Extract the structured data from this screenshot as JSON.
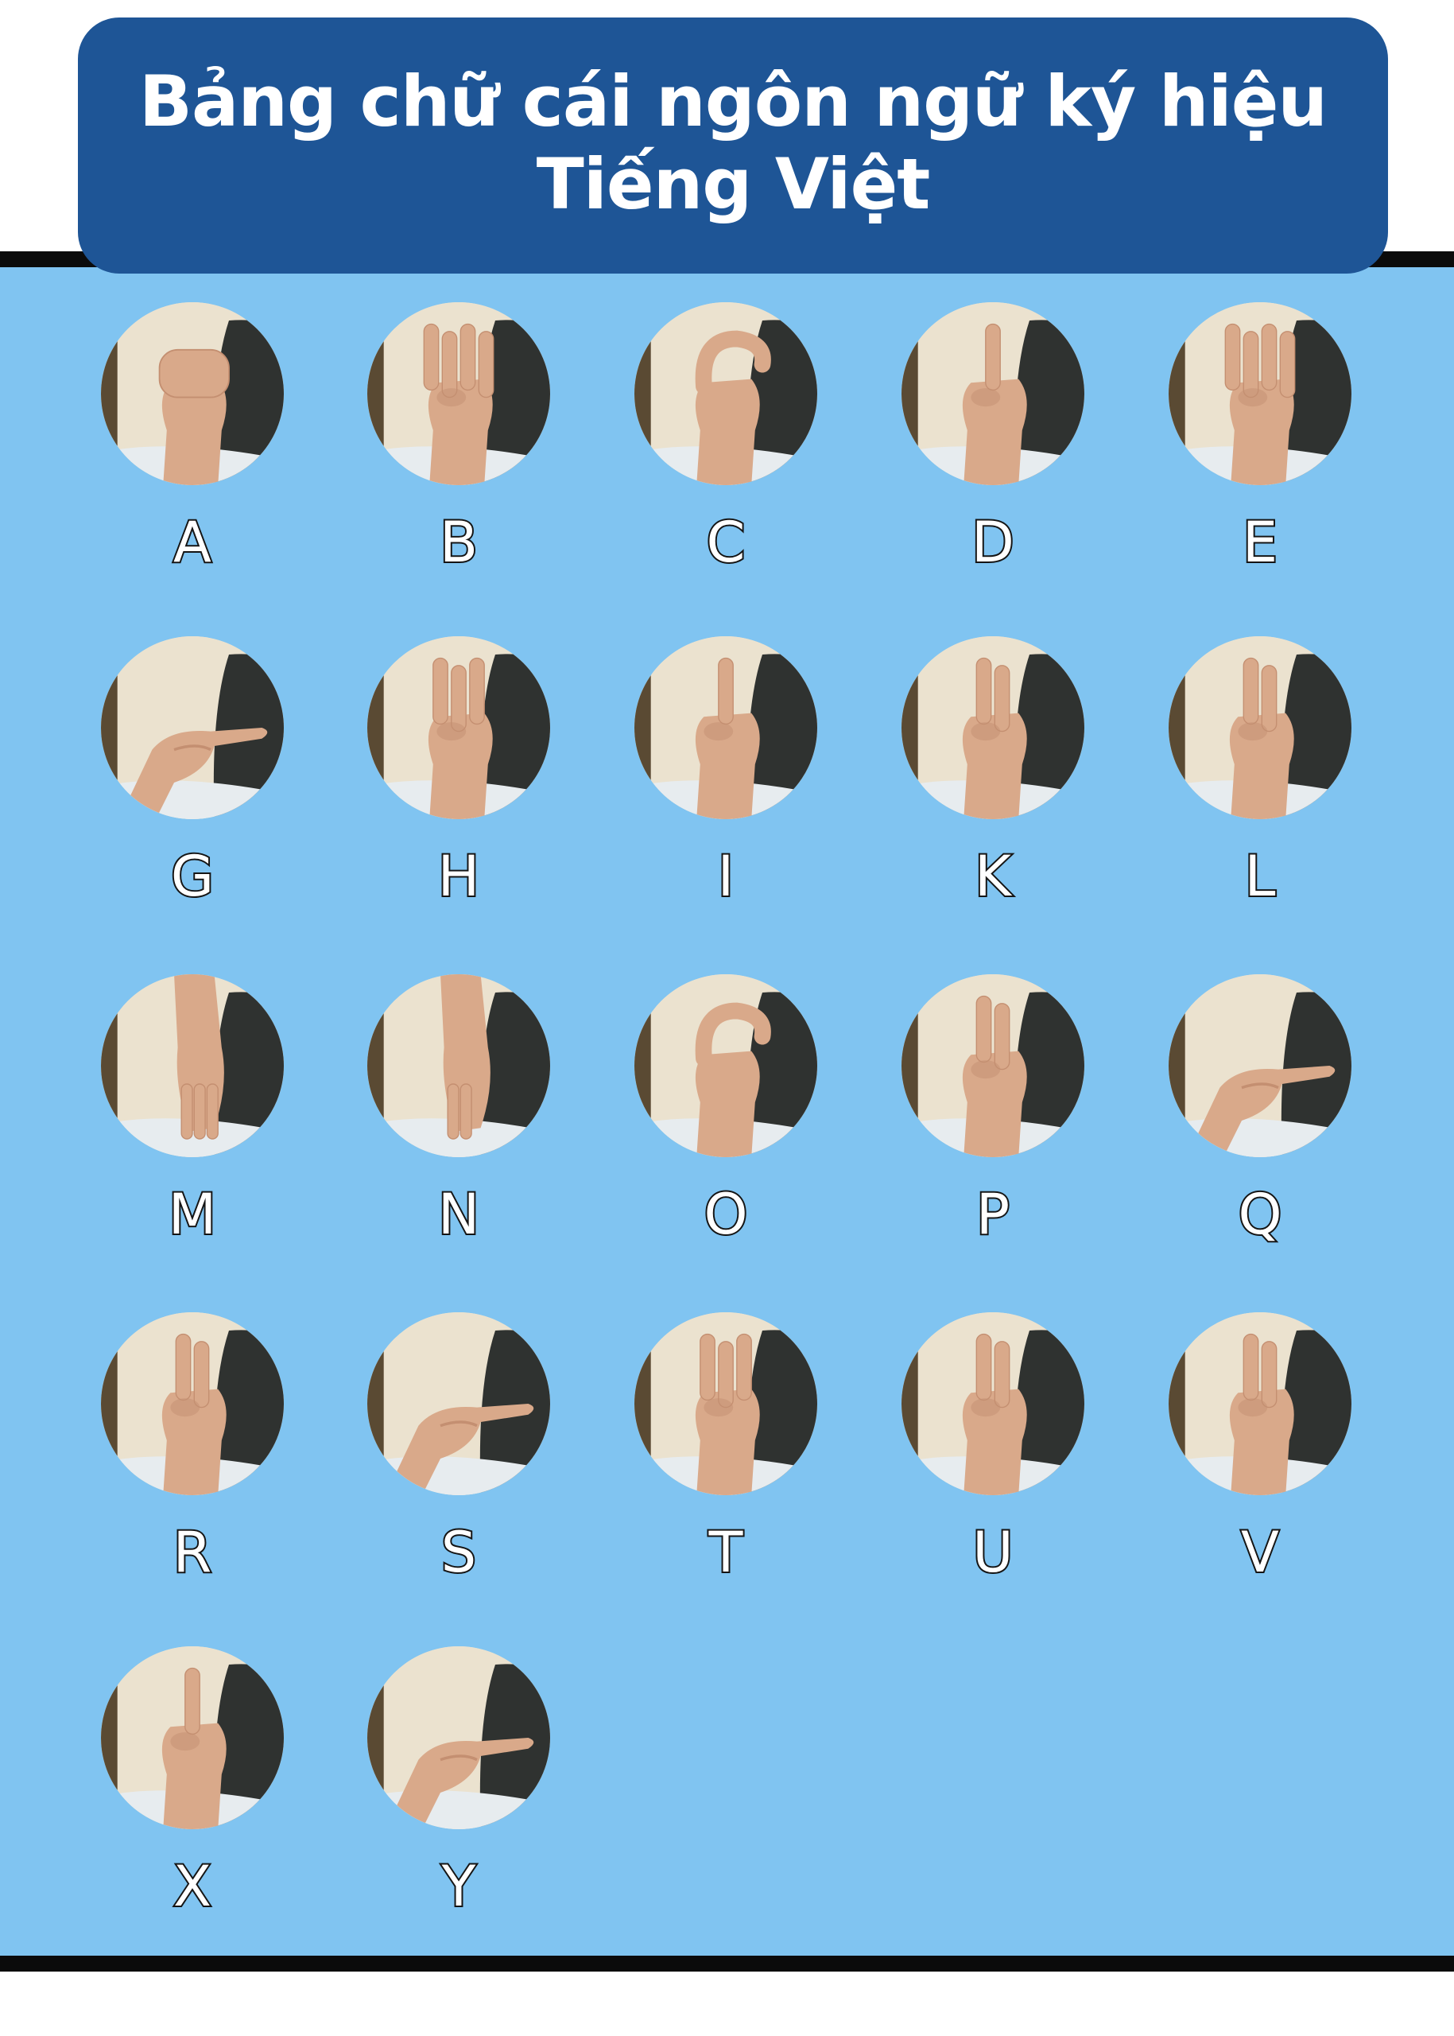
{
  "title": {
    "line1": "Bảng chữ cái ngôn ngữ ký hiệu",
    "line2": "Tiếng Việt"
  },
  "colors": {
    "title_bg": "#1e5596",
    "panel_bg": "#80c4f1",
    "rule": "#0b0b0b",
    "letter_fill": "#ffffff",
    "letter_outline": "#151515"
  },
  "signs": [
    {
      "letter": "A"
    },
    {
      "letter": "B"
    },
    {
      "letter": "C"
    },
    {
      "letter": "D"
    },
    {
      "letter": "E"
    },
    {
      "letter": "G"
    },
    {
      "letter": "H"
    },
    {
      "letter": "I"
    },
    {
      "letter": "K"
    },
    {
      "letter": "L"
    },
    {
      "letter": "M"
    },
    {
      "letter": "N"
    },
    {
      "letter": "O"
    },
    {
      "letter": "P"
    },
    {
      "letter": "Q"
    },
    {
      "letter": "R"
    },
    {
      "letter": "S"
    },
    {
      "letter": "T"
    },
    {
      "letter": "U"
    },
    {
      "letter": "V"
    },
    {
      "letter": "X"
    },
    {
      "letter": "Y"
    }
  ]
}
